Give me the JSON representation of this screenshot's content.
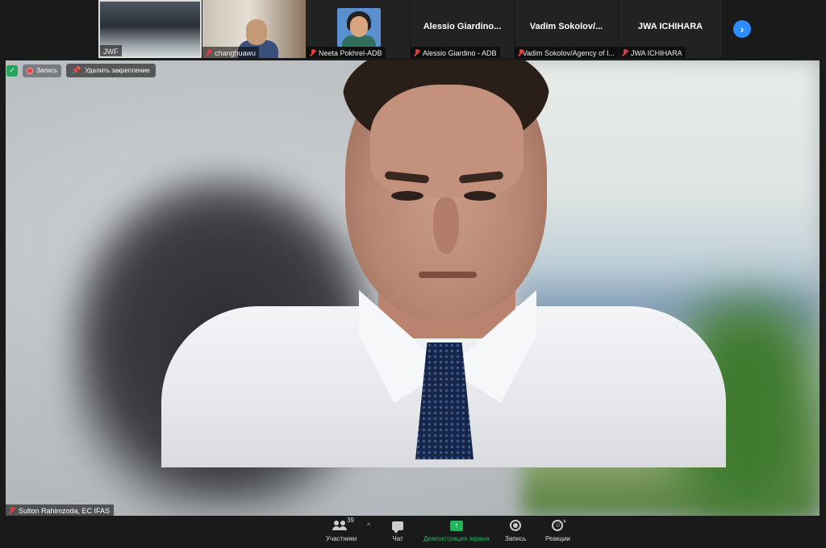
{
  "thumbnails": [
    {
      "name": "JWF",
      "muted": false
    },
    {
      "name": "changhuawu",
      "muted": true
    },
    {
      "name": "Neeta Pokhrel-ADB",
      "muted": true
    },
    {
      "display": "Alessio Giardino...",
      "name": "Alessio Giardino - ADB",
      "muted": true
    },
    {
      "display": "Vadim Sokolov/...",
      "name": "Vadim Sokolov/Agency of I...",
      "muted": true
    },
    {
      "display": "JWA ICHIHARA",
      "name": "JWA ICHIHARA",
      "muted": true
    }
  ],
  "overlay": {
    "recording_label": "Запись",
    "unpin_label": "Удалить закрепление"
  },
  "speaker": {
    "name": "Sulton Rahimzoda, EC IFAS"
  },
  "toolbar": {
    "participants_label": "Участники",
    "participants_count": "39",
    "chat_label": "Чат",
    "share_label": "Демонстрация экрана",
    "record_label": "Запись",
    "reactions_label": "Реакции"
  },
  "colors": {
    "accent_blue": "#2d8cff",
    "share_green": "#23b35a",
    "muted_red": "#e23c3c",
    "toolbar_bg": "#1a1a1a"
  },
  "icons": [
    "mic-off-icon",
    "chevron-right-icon",
    "shield-icon",
    "record-icon",
    "pin-icon",
    "participants-icon",
    "chat-icon",
    "share-screen-icon",
    "reactions-icon"
  ]
}
